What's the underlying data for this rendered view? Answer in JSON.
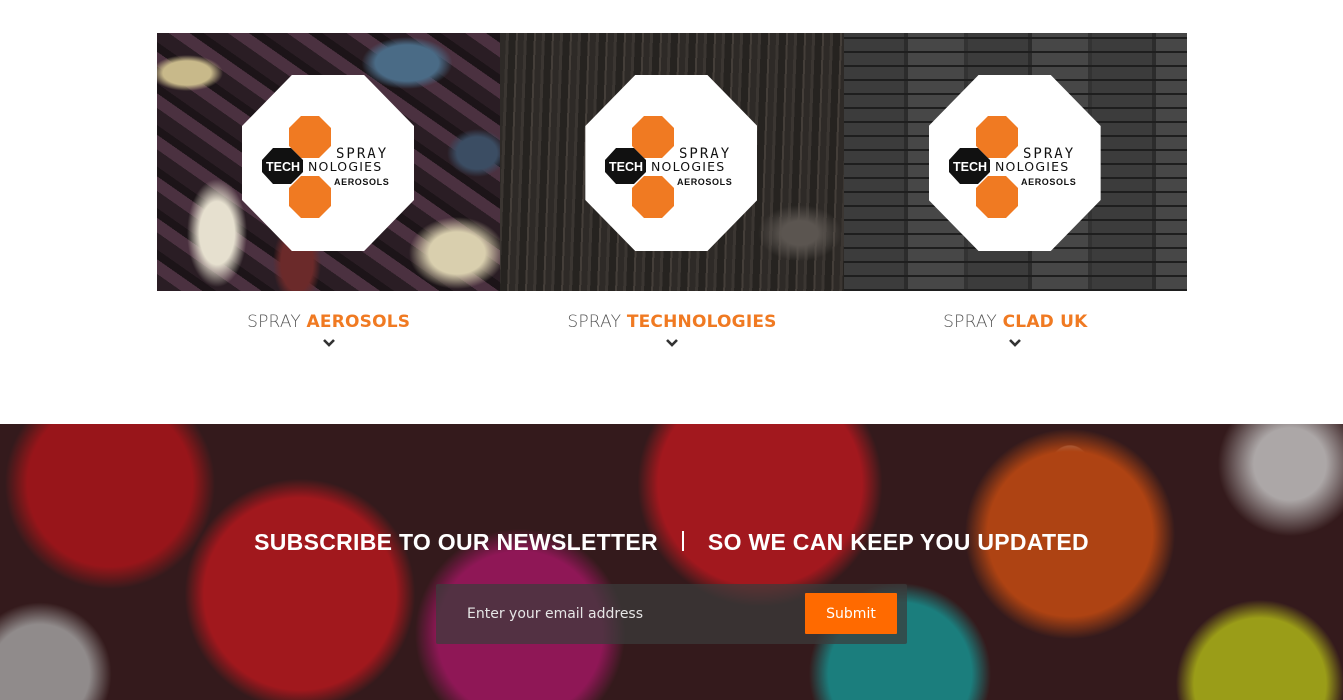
{
  "brands": [
    {
      "logo": {
        "word_top": "SPRAY",
        "word_tech": "TECH",
        "word_nologies": "NOLOGIES",
        "word_bottom": "AEROSOLS"
      },
      "caption_light": "SPRAY",
      "caption_accent": "AEROSOLS",
      "background": "graffiti"
    },
    {
      "logo": {
        "word_top": "SPRAY",
        "word_tech": "TECH",
        "word_nologies": "NOLOGIES",
        "word_bottom": "AEROSOLS"
      },
      "caption_light": "SPRAY",
      "caption_accent": "TECHNOLOGIES",
      "background": "wood"
    },
    {
      "logo": {
        "word_top": "SPRAY",
        "word_tech": "TECH",
        "word_nologies": "NOLOGIES",
        "word_bottom": "AEROSOLS"
      },
      "caption_light": "SPRAY",
      "caption_accent": "CLAD UK",
      "background": "stone"
    }
  ],
  "newsletter": {
    "headline_strong": "SUBSCRIBE TO OUR NEWSLETTER",
    "headline_soft": "SO WE CAN KEEP YOU UPDATED",
    "email_placeholder": "Enter your email address",
    "email_value": "",
    "submit_label": "Submit"
  },
  "colors": {
    "accent": "#f07a22",
    "button": "#ff6a00",
    "logo_dark": "#111111",
    "logo_orange": "#f07a22"
  },
  "icons": {
    "expand": "chevron-down-icon"
  }
}
